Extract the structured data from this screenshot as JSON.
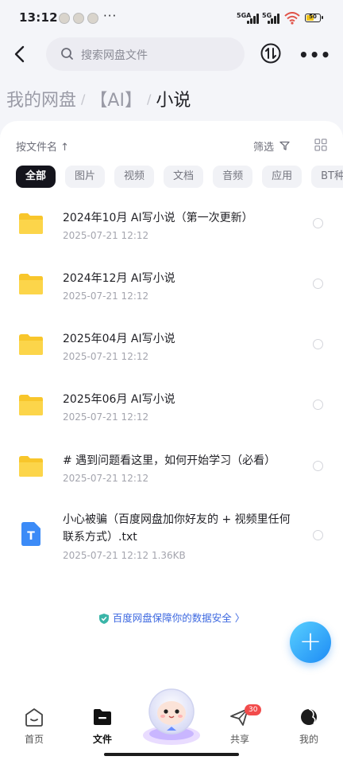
{
  "status": {
    "time": "13:12",
    "more": "···",
    "net1": "5GA",
    "net2": "5G",
    "battery": "50"
  },
  "search": {
    "placeholder": "搜索网盘文件"
  },
  "breadcrumb": {
    "items": [
      "我的网盘",
      "【AI】"
    ],
    "separator": "/",
    "current": "小说"
  },
  "sort": {
    "label": "按文件名 ↑"
  },
  "filter": {
    "label": "筛选"
  },
  "chips": [
    "全部",
    "图片",
    "视频",
    "文档",
    "音频",
    "应用",
    "BT种"
  ],
  "files": [
    {
      "name": "2024年10月 AI写小说（第一次更新）",
      "meta": "2025-07-21  12:12",
      "type": "folder"
    },
    {
      "name": "2024年12月 AI写小说",
      "meta": "2025-07-21  12:12",
      "type": "folder"
    },
    {
      "name": "2025年04月 AI写小说",
      "meta": "2025-07-21  12:12",
      "type": "folder"
    },
    {
      "name": "2025年06月 AI写小说",
      "meta": "2025-07-21  12:12",
      "type": "folder"
    },
    {
      "name": "# 遇到问题看这里，如何开始学习（必看）",
      "meta": "2025-07-21  12:12",
      "type": "folder"
    },
    {
      "name": "小心被骗（百度网盘加你好友的 + 视频里任何联系方式）.txt",
      "meta": "2025-07-21  12:12  1.36KB",
      "type": "txt",
      "icon_letter": "T"
    }
  ],
  "security": {
    "text": "百度网盘保障你的数据安全 〉"
  },
  "fab": {
    "label": "+"
  },
  "nav": {
    "home": "首页",
    "files": "文件",
    "share": "共享",
    "share_badge": "30",
    "me": "我的"
  },
  "colors": {
    "accent": "#3d68e0",
    "folder": "#f8c62b",
    "fab": "#1d8bf5",
    "badge": "#f24b4b"
  }
}
